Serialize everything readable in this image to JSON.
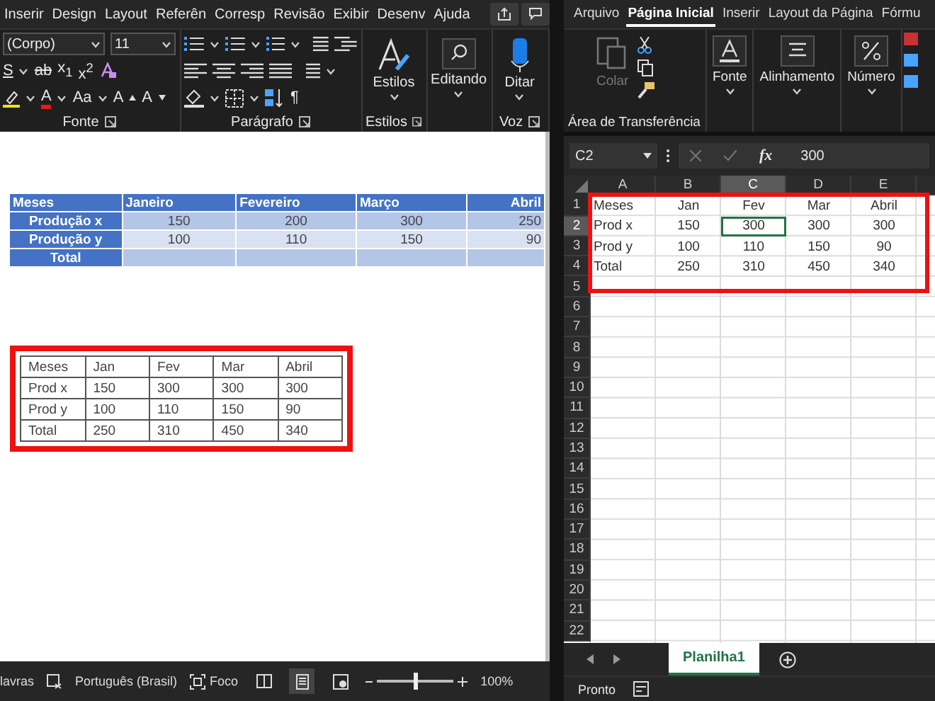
{
  "word": {
    "tabs": [
      "Inserir",
      "Design",
      "Layout",
      "Referên",
      "Corresp",
      "Revisão",
      "Exibir",
      "Desenv",
      "Ajuda"
    ],
    "ribbon": {
      "font_name": "(Corpo)",
      "font_size": "11",
      "font_row_1": [
        {
          "text": "S",
          "kind": "underline"
        },
        {
          "text": "ab",
          "kind": "strike"
        },
        {
          "text": "x$_{1}$",
          "kind": "plain"
        },
        {
          "text": "x$^{2}$",
          "kind": "plain"
        }
      ],
      "font_row_2": [
        {
          "text": "A",
          "kind": "font-color"
        },
        {
          "text": "Aa",
          "kind": "plain"
        },
        {
          "text": "A",
          "kind": "grow"
        },
        {
          "text": "A",
          "kind": "shrink"
        }
      ],
      "paragraph_mark": "¶",
      "styles_button": "Estilos",
      "editing_button": "Editando",
      "dictate_button": "Ditar",
      "group_labels": {
        "font": "Fonte",
        "paragraph": "Parágrafo",
        "styles": "Estilos",
        "voice": "Voz"
      }
    },
    "document": {
      "styled_table": {
        "columns": [
          "Meses",
          "Janeiro",
          "Fevereiro",
          "Março",
          "Abril"
        ],
        "rows": [
          [
            "Produção x",
            "150",
            "200",
            "300",
            "250"
          ],
          [
            "Produção y",
            "100",
            "110",
            "150",
            "90"
          ],
          [
            "Total"
          ]
        ]
      },
      "plain_table": {
        "rows": [
          [
            "Meses",
            "Jan",
            "Fev",
            "Mar",
            "Abril"
          ],
          [
            "Prod x",
            "150",
            "300",
            "300",
            "300"
          ],
          [
            "Prod y",
            "100",
            "110",
            "150",
            "90"
          ],
          [
            "Total",
            "250",
            "310",
            "450",
            "340"
          ]
        ]
      }
    },
    "status_bar": {
      "word_count": "lavras",
      "language": "Português (Brasil)",
      "focus": "Foco",
      "zoom": {
        "level": 0.5
      },
      "zoom_reading": "100%"
    }
  },
  "excel": {
    "tabs": [
      {
        "label": "Arquivo",
        "selected": false
      },
      {
        "label": "Página Inicial",
        "selected": true
      },
      {
        "label": "Inserir",
        "selected": false
      },
      {
        "label": "Layout da Página",
        "selected": false
      },
      {
        "label": "Fórmu",
        "selected": false
      }
    ],
    "ribbon": {
      "paste": {
        "label": "Colar",
        "disabled": true
      },
      "clipboard_group": "Área de Transferência",
      "buttons": [
        "Fonte",
        "Alinhamento",
        "Número"
      ]
    },
    "formula_bar": {
      "name_box": "C2",
      "function_label": "fx",
      "value": "300"
    },
    "columns": [
      {
        "label": "A",
        "selected": false
      },
      {
        "label": "B",
        "selected": false
      },
      {
        "label": "C",
        "selected": true
      },
      {
        "label": "D",
        "selected": false
      },
      {
        "label": "E",
        "selected": false
      }
    ],
    "rows": [
      {
        "label": "1",
        "selected": false,
        "cells": [
          "Meses",
          "Jan",
          "Fev",
          "Mar",
          "Abril"
        ]
      },
      {
        "label": "2",
        "selected": true,
        "cells": [
          "Prod x",
          "150",
          "300",
          "300",
          "300"
        ]
      },
      {
        "label": "3",
        "selected": false,
        "cells": [
          "Prod y",
          "100",
          "110",
          "150",
          "90"
        ]
      },
      {
        "label": "4",
        "selected": false,
        "cells": [
          "Total",
          "250",
          "310",
          "450",
          "340"
        ]
      },
      {
        "label": "5",
        "selected": false,
        "cells": []
      },
      {
        "label": "6",
        "selected": false,
        "cells": []
      },
      {
        "label": "7",
        "selected": false,
        "cells": []
      },
      {
        "label": "8",
        "selected": false,
        "cells": []
      },
      {
        "label": "9",
        "selected": false,
        "cells": []
      },
      {
        "label": "10",
        "selected": false,
        "cells": []
      },
      {
        "label": "11",
        "selected": false,
        "cells": []
      },
      {
        "label": "12",
        "selected": false,
        "cells": []
      },
      {
        "label": "13",
        "selected": false,
        "cells": []
      },
      {
        "label": "14",
        "selected": false,
        "cells": []
      },
      {
        "label": "15",
        "selected": false,
        "cells": []
      },
      {
        "label": "16",
        "selected": false,
        "cells": []
      },
      {
        "label": "17",
        "selected": false,
        "cells": []
      },
      {
        "label": "18",
        "selected": false,
        "cells": []
      },
      {
        "label": "19",
        "selected": false,
        "cells": []
      },
      {
        "label": "20",
        "selected": false,
        "cells": []
      },
      {
        "label": "21",
        "selected": false,
        "cells": []
      },
      {
        "label": "22",
        "selected": false,
        "cells": []
      }
    ],
    "sheet_tabs": [
      {
        "label": "Planilha1",
        "selected": true
      }
    ],
    "status": "Pronto"
  }
}
